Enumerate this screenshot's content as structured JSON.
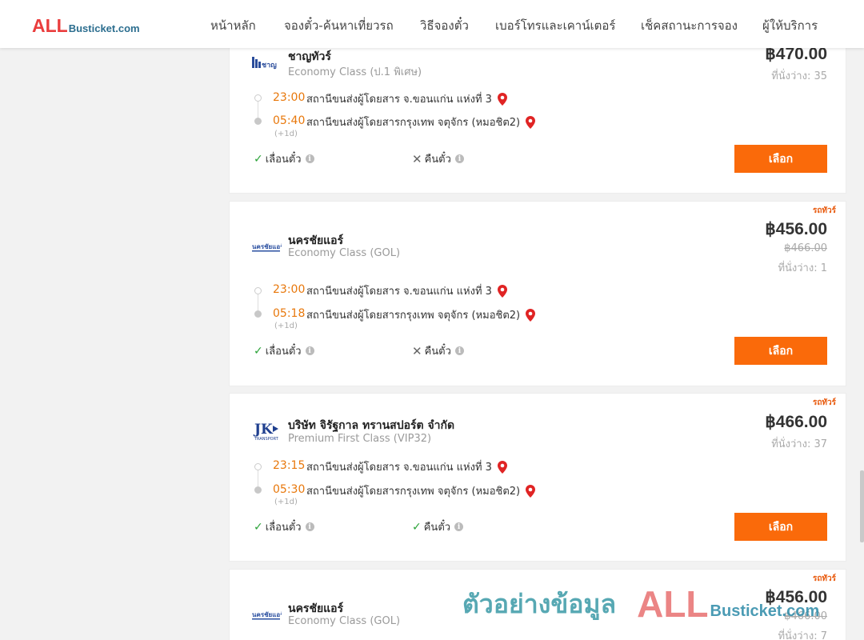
{
  "header": {
    "logo": {
      "all": "ALL",
      "rest": "Busticket.com"
    },
    "nav": [
      "หน้าหลัก",
      "จองตั๋ว-ค้นหาเที่ยวรถ",
      "วิธีจองตั๋ว",
      "เบอร์โทรและเคาน์เตอร์",
      "เช็คสถานะการจอง",
      "ผู้ให้บริการ"
    ]
  },
  "results": [
    {
      "operator": "ชาญทัวร์",
      "class": "Economy Class (ป.1 พิเศษ)",
      "logo_icon": "chantour-logo-icon",
      "promo": "",
      "price": "฿470.00",
      "old_price": "",
      "seats": "ที่นั่งว่าง: 35",
      "depart_time": "23:00",
      "depart_station": "สถานีขนส่งผู้โดยสาร จ.ขอนแก่น แห่งที่ 3",
      "arrive_time": "05:40",
      "arrive_station": "สถานีขนส่งผู้โดยสารกรุงเทพ จตุจักร (หมอชิต2)",
      "next_day": "(+1d)",
      "reschedule": "เลื่อนตั๋ว",
      "reschedule_ok": true,
      "refund": "คืนตั๋ว",
      "refund_ok": false,
      "button": "เลือก"
    },
    {
      "operator": "นครชัยแอร์",
      "class": "Economy Class (GOL)",
      "logo_icon": "nakhonchai-air-logo-icon",
      "promo": "รถทัวร์",
      "price": "฿456.00",
      "old_price": "฿466.00",
      "seats": "ที่นั่งว่าง: 1",
      "depart_time": "23:00",
      "depart_station": "สถานีขนส่งผู้โดยสาร จ.ขอนแก่น แห่งที่ 3",
      "arrive_time": "05:18",
      "arrive_station": "สถานีขนส่งผู้โดยสารกรุงเทพ จตุจักร (หมอชิต2)",
      "next_day": "(+1d)",
      "reschedule": "เลื่อนตั๋ว",
      "reschedule_ok": true,
      "refund": "คืนตั๋ว",
      "refund_ok": false,
      "button": "เลือก"
    },
    {
      "operator": "บริษัท จิรัฐกาล ทรานสปอร์ต จำกัด",
      "class": "Premium First Class (VIP32)",
      "logo_icon": "jk-transport-logo-icon",
      "promo": "รถทัวร์",
      "price": "฿466.00",
      "old_price": "",
      "seats": "ที่นั่งว่าง: 37",
      "depart_time": "23:15",
      "depart_station": "สถานีขนส่งผู้โดยสาร จ.ขอนแก่น แห่งที่ 3",
      "arrive_time": "05:30",
      "arrive_station": "สถานีขนส่งผู้โดยสารกรุงเทพ จตุจักร (หมอชิต2)",
      "next_day": "(+1d)",
      "reschedule": "เลื่อนตั๋ว",
      "reschedule_ok": true,
      "refund": "คืนตั๋ว",
      "refund_ok": true,
      "button": "เลือก"
    },
    {
      "operator": "นครชัยแอร์",
      "class": "Economy Class (GOL)",
      "logo_icon": "nakhonchai-air-logo-icon",
      "promo": "รถทัวร์",
      "price": "฿456.00",
      "old_price": "฿466.00",
      "seats": "ที่นั่งว่าง: 7"
    }
  ],
  "watermark": {
    "text": "ตัวอย่างข้อมูล",
    "all": "ALL",
    "rest": "Busticket.com"
  },
  "colors": {
    "accent": "#fa6a0a",
    "time": "#e8780c",
    "check": "#2aa338",
    "logo_red": "#ea3d3d",
    "logo_blue": "#2c6e8f"
  }
}
